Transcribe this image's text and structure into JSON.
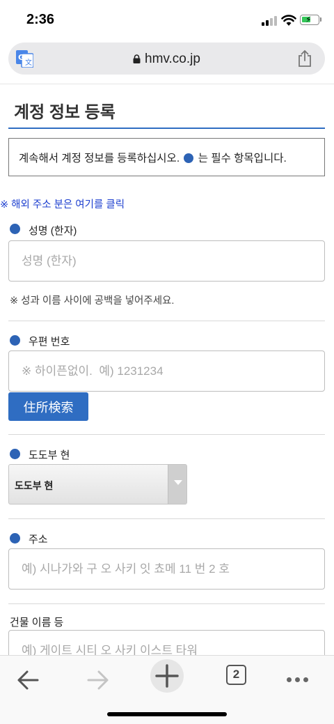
{
  "status": {
    "time": "2:36"
  },
  "browser": {
    "url": "hmv.co.jp",
    "tab_count": "2"
  },
  "page": {
    "title": "계정 정보 등록",
    "notice_before": "계속해서 계정 정보를 등록하십시오.",
    "notice_after": "는 필수 항목입니다.",
    "overseas_link": "※ 해외 주소 분은 여기를 클릭"
  },
  "fields": {
    "name": {
      "label": "성명 (한자)",
      "placeholder": "성명 (한자)",
      "hint": "※ 성과 이름 사이에 공백을 넣어주세요."
    },
    "postal": {
      "label": "우편 번호",
      "placeholder": "※ 하이픈없이.  예) 1231234",
      "search_button": "住所検索"
    },
    "prefecture": {
      "label": "도도부 현",
      "selected": "도도부 현"
    },
    "address": {
      "label": "주소",
      "placeholder": "예) 시나가와 구 오 사키 잇 쵸메 11 번 2 호"
    },
    "building": {
      "label": "건물 이름 등",
      "placeholder": "예) 게이트 시티 오 사키 이스트 타워"
    }
  },
  "colors": {
    "accent": "#2f6dc2",
    "required_dot": "#2d63b5",
    "link": "#1d3fcf"
  }
}
